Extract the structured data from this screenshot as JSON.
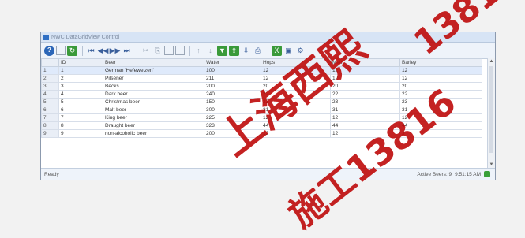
{
  "window": {
    "title": "NWC DataGridView Control"
  },
  "toolbar": {
    "buttons": [
      "help-icon",
      "grid-icon",
      "refresh-icon",
      "first-icon",
      "prev-page-icon",
      "next-page-icon",
      "last-icon",
      "cut-icon",
      "copy-icon",
      "paste-icon",
      "new-icon",
      "sort-asc-icon",
      "sort-desc-icon",
      "filter-icon",
      "export-icon",
      "import-icon",
      "print-icon",
      "excel-icon",
      "settings-icon"
    ]
  },
  "table": {
    "columns": [
      "ID",
      "Beer",
      "Water",
      "Hops",
      "Malt",
      "Barley"
    ],
    "rows": [
      {
        "n": "1",
        "id": "1",
        "beer": "German 'Hefeweizen'",
        "water": "100",
        "hops": "12",
        "malt": "12",
        "barley": "12"
      },
      {
        "n": "2",
        "id": "2",
        "beer": "Pilsener",
        "water": "211",
        "hops": "12",
        "malt": "12",
        "barley": "12"
      },
      {
        "n": "3",
        "id": "3",
        "beer": "Becks",
        "water": "200",
        "hops": "20",
        "malt": "20",
        "barley": "20"
      },
      {
        "n": "4",
        "id": "4",
        "beer": "Dark beer",
        "water": "240",
        "hops": "22",
        "malt": "22",
        "barley": "22"
      },
      {
        "n": "5",
        "id": "5",
        "beer": "Christmas beer",
        "water": "150",
        "hops": "23",
        "malt": "23",
        "barley": "23"
      },
      {
        "n": "6",
        "id": "6",
        "beer": "Malt beer",
        "water": "300",
        "hops": "31",
        "malt": "31",
        "barley": "31"
      },
      {
        "n": "7",
        "id": "7",
        "beer": "King beer",
        "water": "225",
        "hops": "12",
        "malt": "12",
        "barley": "12"
      },
      {
        "n": "8",
        "id": "8",
        "beer": "Draught beer",
        "water": "323",
        "hops": "44",
        "malt": "44",
        "barley": "44"
      },
      {
        "n": "9",
        "id": "9",
        "beer": "non-alcoholic beer",
        "water": "200",
        "hops": "12",
        "malt": "12",
        "barley": "3"
      }
    ]
  },
  "status": {
    "left": "Ready",
    "right": "Active Beers: 9",
    "time": "9:51:15 AM"
  },
  "watermark": {
    "line1": "上海西熙",
    "line2": "13816",
    "line3": "施工13816"
  },
  "colors": {
    "watermark": "#be0a0a",
    "accent": "#2f6fc4"
  }
}
